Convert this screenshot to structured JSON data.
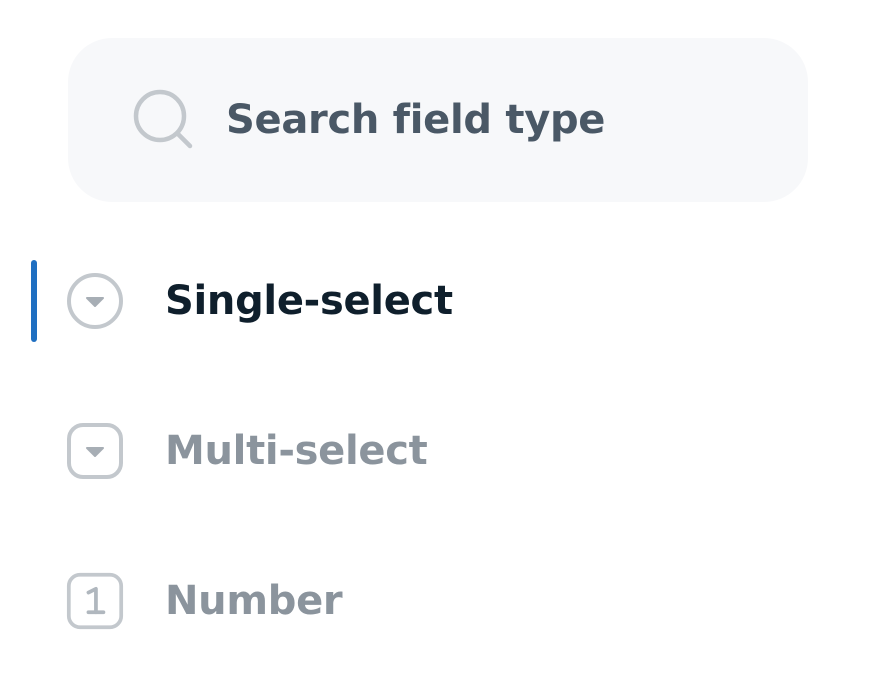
{
  "search": {
    "placeholder": "Search field type",
    "icon": "search-icon"
  },
  "field_types": [
    {
      "label": "Single-select",
      "icon": "circle-chevron-down-icon",
      "active": true
    },
    {
      "label": "Multi-select",
      "icon": "square-chevron-down-icon",
      "active": false
    },
    {
      "label": "Number",
      "icon": "number-one-icon",
      "active": false
    }
  ],
  "colors": {
    "accent": "#1f6fc1",
    "active_text": "#0f1f2c",
    "inactive_text": "#8b949d",
    "icon_gray": "#c3c8cd",
    "search_bg": "#f7f8fa",
    "search_text": "#4a5866"
  }
}
